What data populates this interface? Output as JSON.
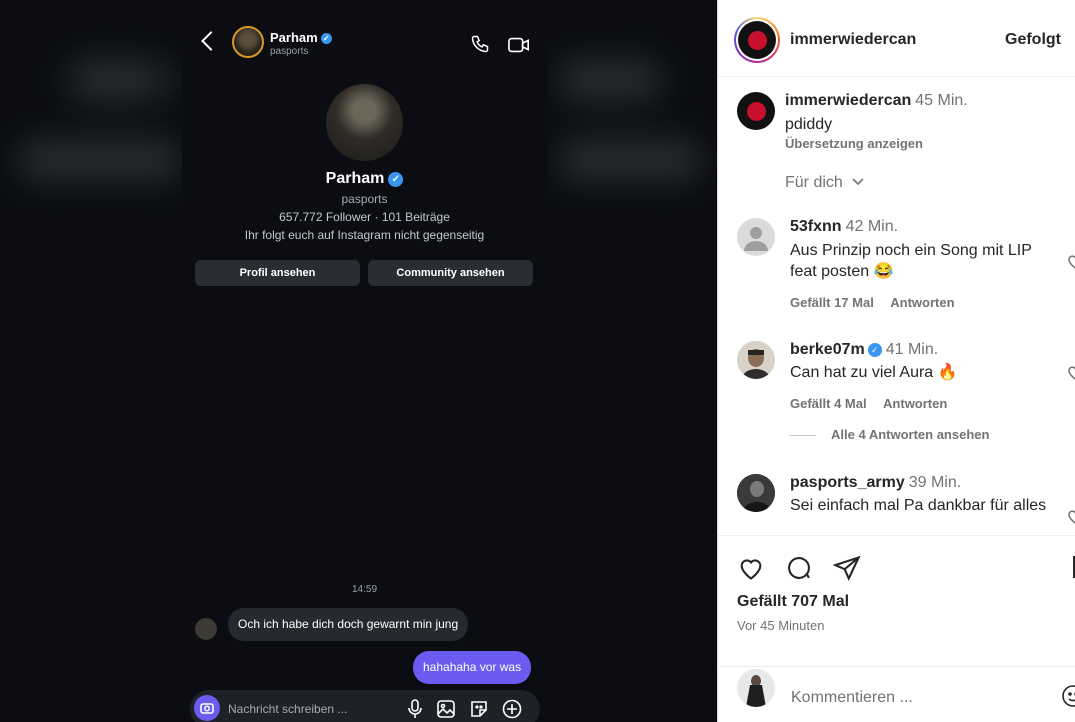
{
  "dm": {
    "header_name": "Parham",
    "header_user": "pasports",
    "profile_name": "Parham",
    "profile_user": "pasports",
    "profile_stats": "657.772 Follower · 101 Beiträge",
    "profile_mutual": "Ihr folgt euch auf Instagram nicht gegenseitig",
    "btn_profile": "Profil ansehen",
    "btn_community": "Community ansehen",
    "timestamp": "14:59",
    "msg_in": "Och ich habe dich doch gewarnt min jung",
    "msg_out": "hahahaha vor was",
    "composer_placeholder": "Nachricht schreiben ..."
  },
  "post": {
    "owner": "immerwiedercan",
    "follow_label": "Gefolgt",
    "caption_user": "immerwiedercan",
    "caption_time": "45 Min.",
    "caption_text": "pdiddy",
    "translate": "Übersetzung anzeigen",
    "sort_label": "Für dich",
    "comments": [
      {
        "user": "53fxnn",
        "time": "42 Min.",
        "text": "Aus Prinzip noch ein Song mit LIP feat posten 😂",
        "likes": "Gefällt 17 Mal",
        "reply": "Antworten"
      },
      {
        "user": "berke07m",
        "time": "41 Min.",
        "text": "Can hat zu viel Aura 🔥",
        "likes": "Gefällt 4 Mal",
        "reply": "Antworten",
        "view_replies": "Alle 4 Antworten ansehen"
      },
      {
        "user": "pasports_army",
        "time": "39 Min.",
        "text": "Sei einfach mal Pa dankbar für alles"
      }
    ],
    "likes_total": "Gefällt 707 Mal",
    "time_ago": "Vor 45 Minuten",
    "comment_placeholder": "Kommentieren ..."
  }
}
